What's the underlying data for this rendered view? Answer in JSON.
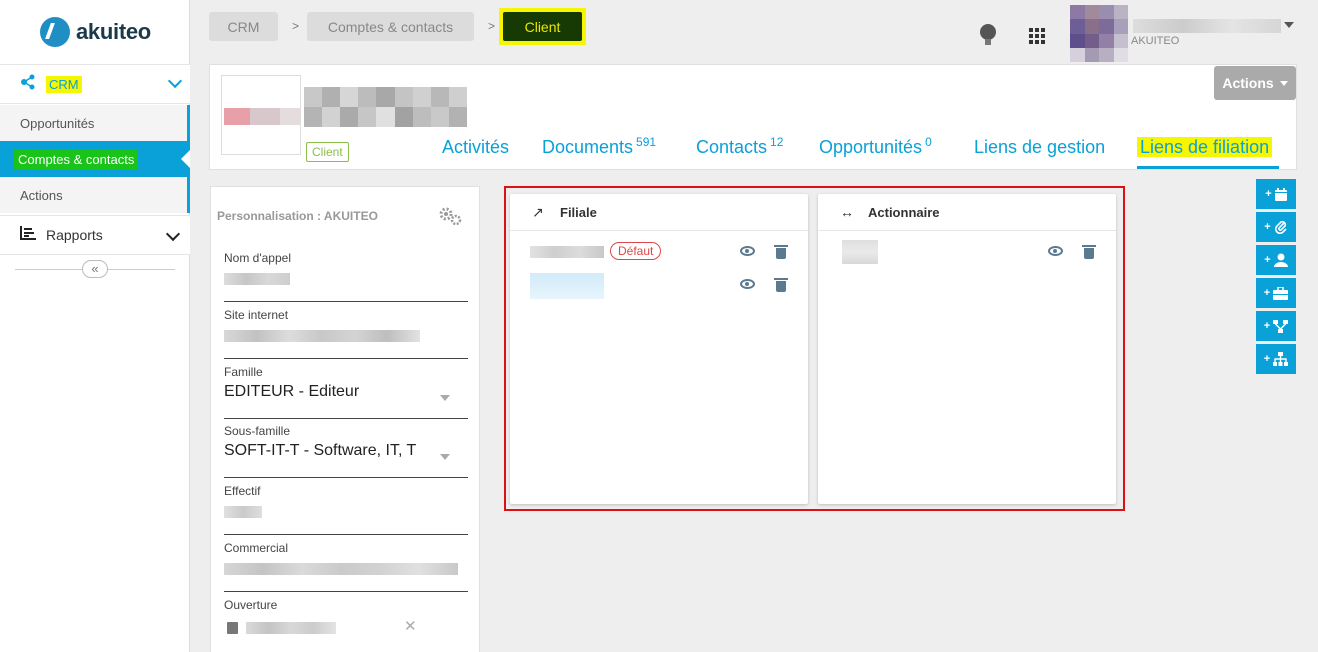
{
  "brand": {
    "name": "akuiteo"
  },
  "sidebar": {
    "crm_label": "CRM",
    "items": [
      {
        "label": "Opportunités"
      },
      {
        "label": "Comptes & contacts"
      },
      {
        "label": "Actions"
      }
    ],
    "rapports_label": "Rapports",
    "collapse_glyph": "«"
  },
  "breadcrumb": {
    "items": [
      "CRM",
      "Comptes & contacts",
      "Client"
    ],
    "separator": ">"
  },
  "user": {
    "org": "AKUITEO"
  },
  "header": {
    "type_badge": "Client",
    "actions_label": "Actions",
    "tabs": [
      {
        "label": "Activités",
        "count": ""
      },
      {
        "label": "Documents",
        "count": "591"
      },
      {
        "label": "Contacts",
        "count": "12"
      },
      {
        "label": "Opportunités",
        "count": "0"
      },
      {
        "label": "Liens de gestion",
        "count": ""
      },
      {
        "label": "Liens de filiation",
        "count": ""
      }
    ]
  },
  "perso": {
    "title": "Personnalisation : AKUITEO",
    "fields": [
      {
        "label": "Nom d'appel"
      },
      {
        "label": "Site internet"
      },
      {
        "label": "Famille",
        "value": "EDITEUR - Editeur"
      },
      {
        "label": "Sous-famille",
        "value": "SOFT-IT-T - Software, IT, T"
      },
      {
        "label": "Effectif"
      },
      {
        "label": "Commercial"
      },
      {
        "label": "Ouverture"
      }
    ]
  },
  "filiation": {
    "filiale": {
      "title": "Filiale",
      "icon": "↗",
      "default_badge": "Défaut"
    },
    "actionnaire": {
      "title": "Actionnaire",
      "icon": "↔"
    }
  },
  "quick_add": [
    "calendar-icon",
    "paperclip-icon",
    "user-icon",
    "briefcase-icon",
    "share-icon",
    "sitemap-icon"
  ],
  "colors": {
    "accent": "#0aa0d8",
    "highlight": "#f6f600",
    "active_green": "#19c319",
    "frame_red": "#dd1111"
  }
}
